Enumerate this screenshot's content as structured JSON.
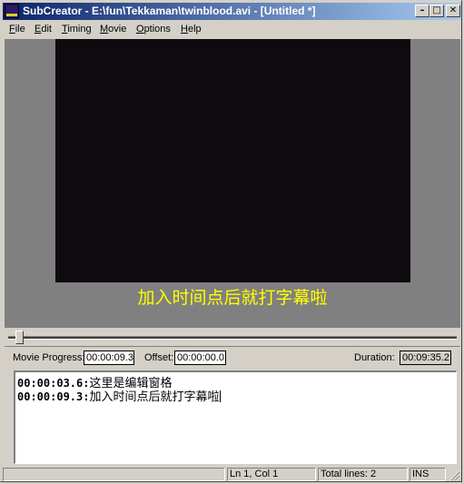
{
  "window": {
    "title": "SubCreator - E:\\fun\\Tekkaman\\twinblood.avi - [Untitled *]",
    "minimize_glyph": "–",
    "maximize_glyph": "□",
    "close_glyph": "✕"
  },
  "menu": [
    {
      "label": "File",
      "accel": "F",
      "rest": "ile"
    },
    {
      "label": "Edit",
      "accel": "E",
      "rest": "dit"
    },
    {
      "label": "Timing",
      "accel": "T",
      "rest": "iming"
    },
    {
      "label": "Movie",
      "accel": "M",
      "rest": "ovie"
    },
    {
      "label": "Options",
      "accel": "O",
      "rest": "ptions"
    },
    {
      "label": "Help",
      "accel": "H",
      "rest": "elp"
    }
  ],
  "video": {
    "subtitle_overlay": "加入时间点后就打字幕啦"
  },
  "seek": {
    "progress": 0.016
  },
  "info": {
    "movie_progress_label": "Movie Progress:",
    "movie_progress_value": "00:00:09.3",
    "offset_label": "Offset:",
    "offset_value": "00:00:00.0",
    "duration_label": "Duration:",
    "duration_value": "00:09:35.2"
  },
  "editor": {
    "lines": [
      {
        "timestamp": "00:00:03.6:",
        "text": "这里是编辑窗格"
      },
      {
        "timestamp": "00:00:09.3:",
        "text": "加入时间点后就打字幕啦"
      }
    ]
  },
  "status": {
    "position": "Ln 1, Col 1",
    "total_lines": "Total lines: 2",
    "mode": "INS"
  },
  "colors": {
    "subtitle": "#ffff00",
    "video_bg": "#0f0a10",
    "titlebar_start": "#0a246a",
    "titlebar_end": "#a6caf0"
  }
}
